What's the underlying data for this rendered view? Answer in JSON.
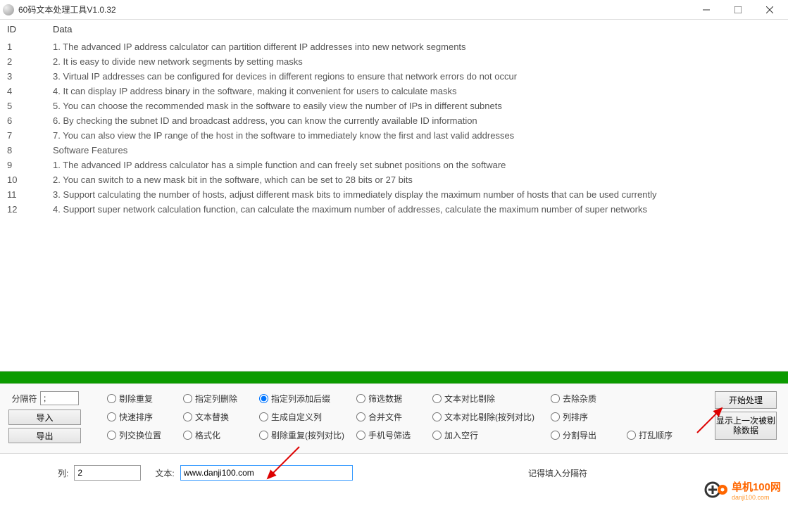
{
  "title": "60码文本处理工具V1.0.32",
  "columns": {
    "id": "ID",
    "data": "Data"
  },
  "rows": [
    {
      "id": "1",
      "data": "1. The advanced IP address calculator can partition different IP addresses into new network segments"
    },
    {
      "id": "2",
      "data": "2. It is easy to divide new network segments by setting masks"
    },
    {
      "id": "3",
      "data": "3. Virtual IP addresses can be configured for devices in different regions to ensure that network errors do not occur"
    },
    {
      "id": "4",
      "data": "4. It can display IP address binary in the software, making it convenient for users to calculate masks"
    },
    {
      "id": "5",
      "data": "5. You can choose the recommended mask in the software to easily view the number of IPs in different subnets"
    },
    {
      "id": "6",
      "data": "6. By checking the subnet ID and broadcast address, you can know the currently available ID information"
    },
    {
      "id": "7",
      "data": "7. You can also view the IP range of the host in the software to immediately know the first and last valid addresses"
    },
    {
      "id": "8",
      "data": "Software Features"
    },
    {
      "id": "9",
      "data": "1. The advanced IP address calculator has a simple function and can freely set subnet positions on the software"
    },
    {
      "id": "10",
      "data": "2. You can switch to a new mask bit in the software, which can be set to 28 bits or 27 bits"
    },
    {
      "id": "11",
      "data": "3. Support calculating the number of hosts, adjust different mask bits to immediately display the maximum number of hosts that can be used currently"
    },
    {
      "id": "12",
      "data": "4. Support super network calculation function, can calculate the maximum number of addresses, calculate the maximum number of super networks"
    }
  ],
  "left": {
    "sep_label": "分隔符",
    "sep_value": ";",
    "import": "导入",
    "export": "导出"
  },
  "radios": {
    "r1": [
      "剔除重复",
      "指定列删除",
      "指定列添加后缀",
      "筛选数据",
      "文本对比剔除",
      "去除杂质"
    ],
    "r2": [
      "快速排序",
      "文本替换",
      "生成自定义列",
      "合并文件",
      "文本对比剔除(按列对比)",
      "列排序"
    ],
    "r3": [
      "列交换位置",
      "格式化",
      "剔除重复(按列对比)",
      "手机号筛选",
      "加入空行",
      "分割导出",
      "打乱顺序"
    ]
  },
  "selected_radio": "指定列添加后缀",
  "right": {
    "start": "开始处理",
    "show_last": "显示上一次被剔除数据"
  },
  "bottom": {
    "col_label": "列:",
    "col_value": "2",
    "text_label": "文本:",
    "text_value": "www.danji100.com",
    "note": "记得填入分隔符"
  },
  "logo": {
    "cn": "单机100网",
    "en": "danji100.com"
  }
}
